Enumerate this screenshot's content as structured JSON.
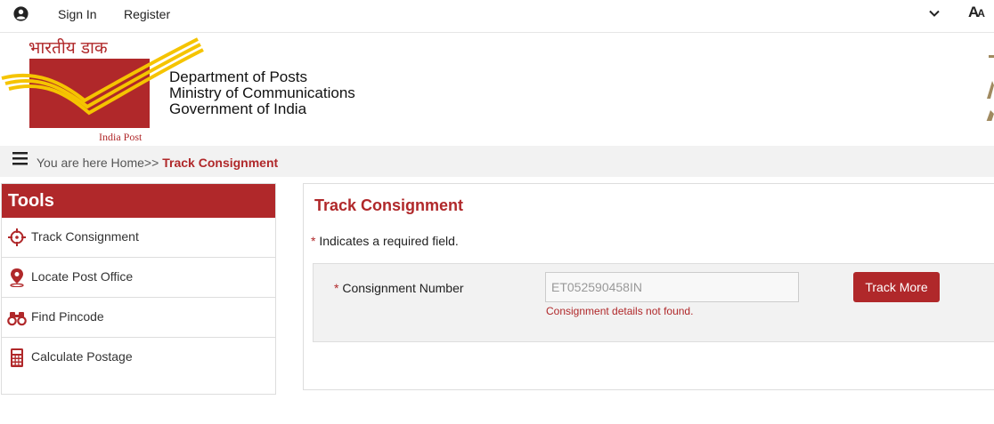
{
  "topbar": {
    "sign_in": "Sign In",
    "register": "Register",
    "font_toggle_big": "A",
    "font_toggle_small": "A"
  },
  "header": {
    "logo_hindi": "भारतीय डाक",
    "logo_english": "India Post",
    "dept_line1": "Department of Posts",
    "dept_line2": "Ministry of Communications",
    "dept_line3": "Government of India"
  },
  "breadcrumb": {
    "prefix": "You are here Home>>",
    "current": "Track Consignment"
  },
  "tools": {
    "heading": "Tools",
    "items": [
      {
        "label": "Track Consignment",
        "icon": "crosshair-icon"
      },
      {
        "label": "Locate Post Office",
        "icon": "map-pin-icon"
      },
      {
        "label": "Find Pincode",
        "icon": "binoculars-icon"
      },
      {
        "label": "Calculate Postage",
        "icon": "calculator-icon"
      }
    ]
  },
  "main": {
    "title": "Track Consignment",
    "required_star": "*",
    "required_note": "Indicates a required field.",
    "field_label": "Consignment Number",
    "field_value": "ET052590458IN",
    "error": "Consignment details not found.",
    "button": "Track More"
  },
  "colors": {
    "brand_red": "#b0282a",
    "logo_yellow": "#f5c400",
    "panel_gray": "#f2f2f2"
  }
}
